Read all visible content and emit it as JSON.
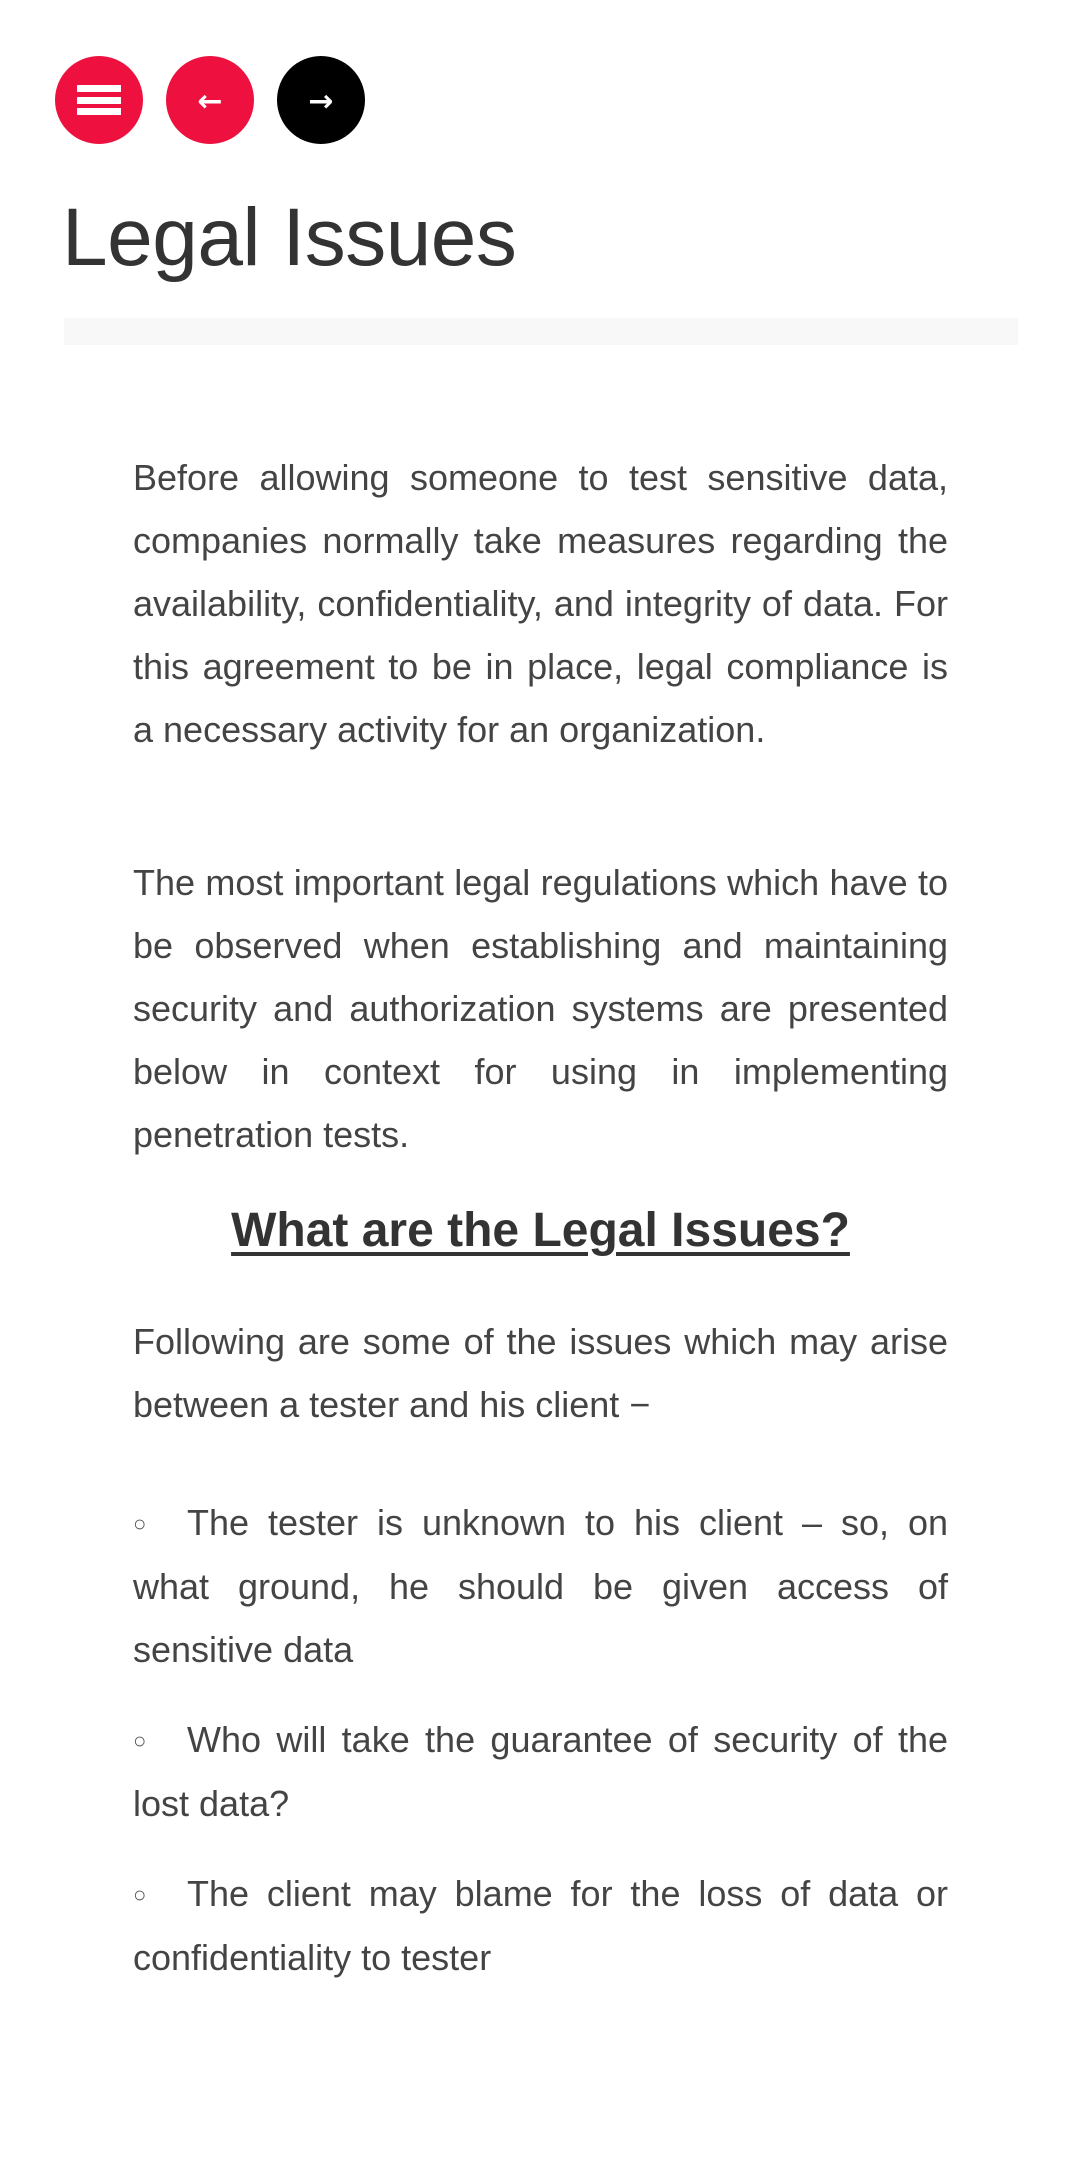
{
  "nav": {
    "menu_icon": "hamburger-menu-icon",
    "prev_icon": "arrow-left-icon",
    "prev_glyph": "←",
    "next_icon": "arrow-right-icon",
    "next_glyph": "→",
    "colors": {
      "menu": "#ee1140",
      "prev": "#ee1140",
      "next": "#000000"
    }
  },
  "page": {
    "title": "Legal Issues"
  },
  "content": {
    "paragraphs": [
      "Before allowing someone to test sensitive data, companies normally take measures regarding the availability, confidentiality, and integrity of data. For this agreement to be in place, legal compliance is a necessary activity for an organization.",
      "The most important legal regulations which have to be observed when establishing and maintaining security and authorization systems are presented below in context for using in implementing penetration tests."
    ],
    "section_heading": "What are the Legal Issues?",
    "intro": "Following are some of the issues which may arise between a tester and his client −",
    "bullet_glyph": "○",
    "issues": [
      "The tester is unknown to his client – so, on what ground, he should be given access of sensitive data",
      "Who will take the guarantee of security of the lost data?",
      "The client may blame for the loss of data or confidentiality to tester"
    ]
  }
}
